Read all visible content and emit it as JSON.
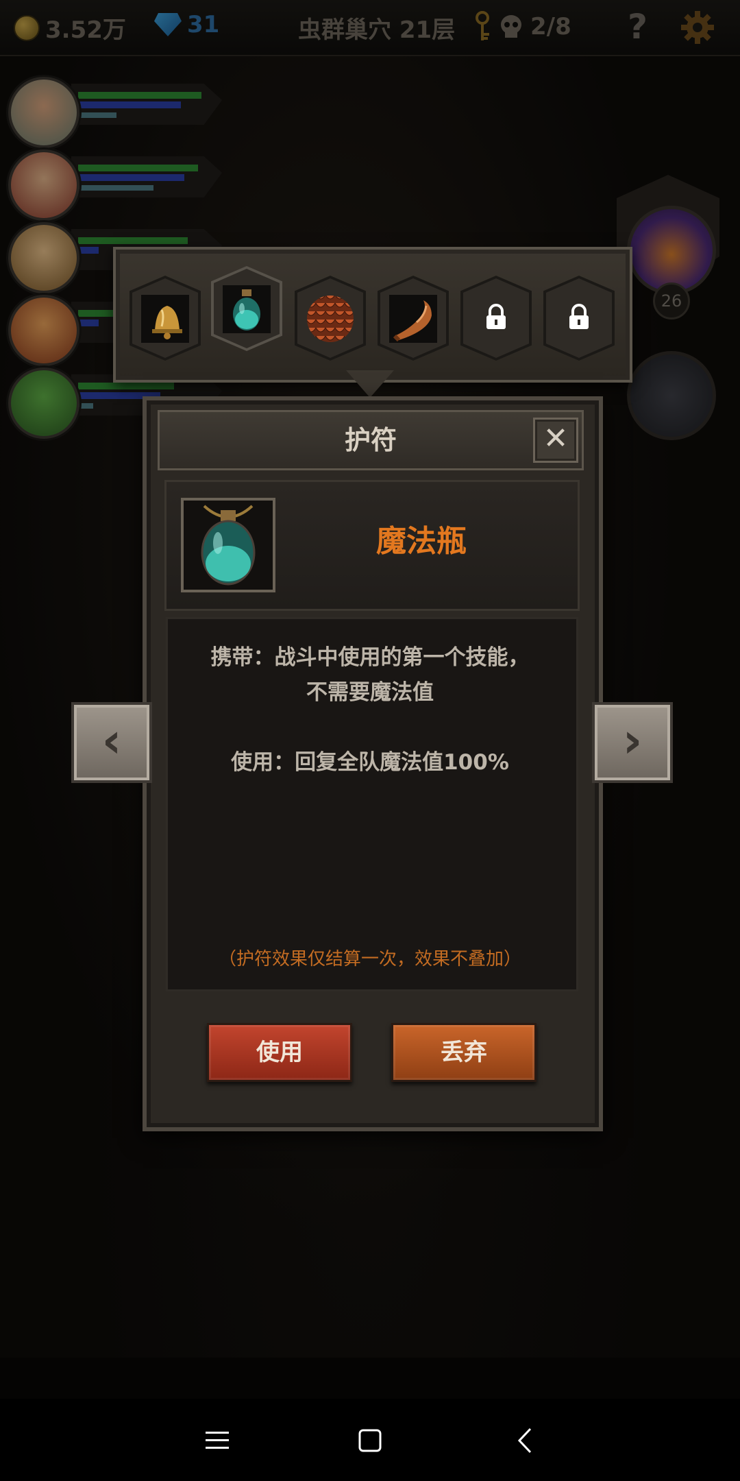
{
  "hud": {
    "gold": "3.52万",
    "gems": "31",
    "floor": "虫群巢穴 21层",
    "kills": "2/8",
    "help": "?"
  },
  "boss": {
    "level": "26"
  },
  "heroes": [
    {
      "name": "hero-1",
      "hp": 0.95,
      "mp": 0.72,
      "xp": 0.3
    },
    {
      "name": "hero-2",
      "hp": 0.9,
      "mp": 0.78,
      "xp": 0.55
    },
    {
      "name": "hero-3",
      "hp": 0.8,
      "mp": 0.1,
      "xp": 0.0
    },
    {
      "name": "hero-4",
      "hp": 0.6,
      "mp": 0.1,
      "xp": 0.0
    },
    {
      "name": "hero-5",
      "hp": 0.7,
      "mp": 0.6,
      "xp": 0.1
    }
  ],
  "amulets": {
    "slots": [
      {
        "icon": "bell-icon",
        "locked": false,
        "selected": false
      },
      {
        "icon": "potion-bottle-icon",
        "locked": false,
        "selected": true
      },
      {
        "icon": "scale-armor-icon",
        "locked": false,
        "selected": false
      },
      {
        "icon": "horn-icon",
        "locked": false,
        "selected": false
      },
      {
        "icon": "lock-icon",
        "locked": true,
        "selected": false
      },
      {
        "icon": "lock-icon",
        "locked": true,
        "selected": false
      }
    ]
  },
  "dialog": {
    "title": "护符",
    "close": "✕",
    "item_name": "魔法瓶",
    "desc_line1": "携带：战斗中使用的第一个技能，",
    "desc_line2": "不需要魔法值",
    "desc_line3": "使用：回复全队魔法值100%",
    "note": "（护符效果仅结算一次，效果不叠加）",
    "use_label": "使用",
    "drop_label": "丢弃"
  },
  "nav": {
    "prev": "‹",
    "next": "›"
  },
  "colors": {
    "item_name": "#e3781f",
    "note": "#c46c22",
    "use_button": "#b23a24",
    "drop_button": "#c05a22"
  }
}
